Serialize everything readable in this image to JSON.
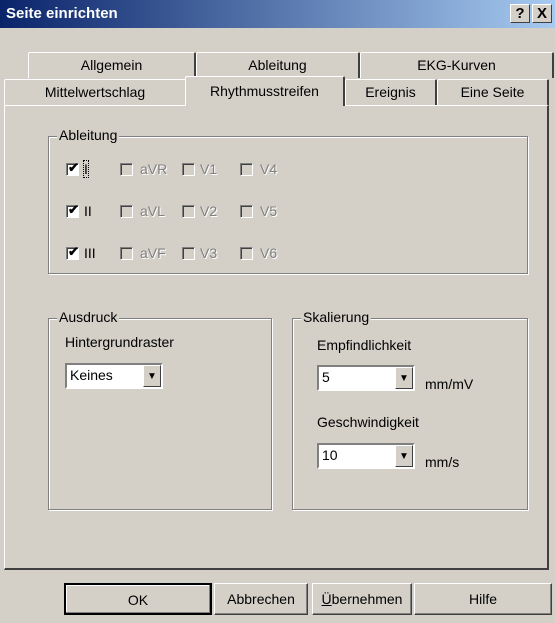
{
  "window": {
    "title": "Seite einrichten",
    "help_glyph": "?",
    "close_glyph": "X"
  },
  "tabs_row1": [
    "Allgemein",
    "Ableitung",
    "EKG-Kurven"
  ],
  "tabs_row2": [
    "Mittelwertschlag",
    "Rhythmusstreifen",
    "Ereignis",
    "Eine Seite"
  ],
  "active_tab": "Rhythmusstreifen",
  "ableitung": {
    "legend": "Ableitung",
    "leads": [
      {
        "label": "I",
        "checked": true,
        "enabled": true
      },
      {
        "label": "aVR",
        "checked": false,
        "enabled": false
      },
      {
        "label": "V1",
        "checked": false,
        "enabled": false
      },
      {
        "label": "V4",
        "checked": false,
        "enabled": false
      },
      {
        "label": "II",
        "checked": true,
        "enabled": true
      },
      {
        "label": "aVL",
        "checked": false,
        "enabled": false
      },
      {
        "label": "V2",
        "checked": false,
        "enabled": false
      },
      {
        "label": "V5",
        "checked": false,
        "enabled": false
      },
      {
        "label": "III",
        "checked": true,
        "enabled": true
      },
      {
        "label": "aVF",
        "checked": false,
        "enabled": false
      },
      {
        "label": "V3",
        "checked": false,
        "enabled": false
      },
      {
        "label": "V6",
        "checked": false,
        "enabled": false
      }
    ]
  },
  "ausdruck": {
    "legend": "Ausdruck",
    "label": "Hintergrundraster",
    "value": "Keines"
  },
  "skalierung": {
    "legend": "Skalierung",
    "sens_label": "Empfindlichkeit",
    "sens_value": "5",
    "sens_unit": "mm/mV",
    "speed_label": "Geschwindigkeit",
    "speed_value": "10",
    "speed_unit": "mm/s"
  },
  "buttons": {
    "ok": "OK",
    "cancel": "Abbrechen",
    "apply_u": "Ü",
    "apply_rest": "bernehmen",
    "help": "Hilfe"
  }
}
